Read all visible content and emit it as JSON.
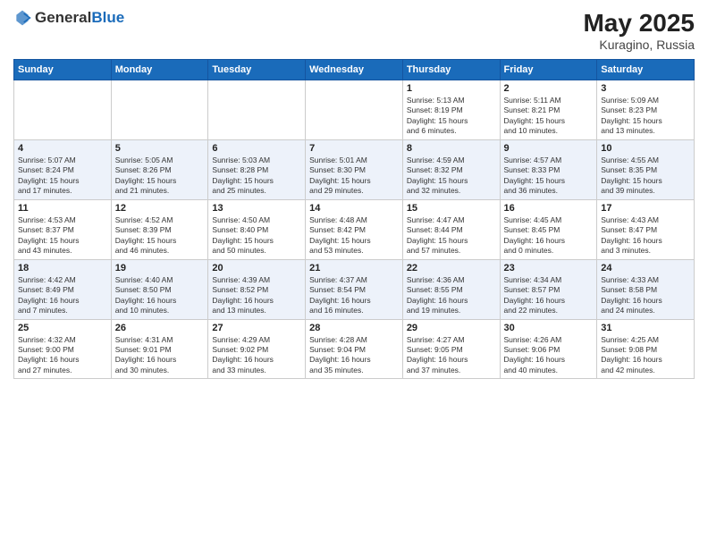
{
  "header": {
    "logo_general": "General",
    "logo_blue": "Blue",
    "month_year": "May 2025",
    "location": "Kuragino, Russia"
  },
  "days_of_week": [
    "Sunday",
    "Monday",
    "Tuesday",
    "Wednesday",
    "Thursday",
    "Friday",
    "Saturday"
  ],
  "weeks": [
    {
      "days": [
        {
          "number": "",
          "info": ""
        },
        {
          "number": "",
          "info": ""
        },
        {
          "number": "",
          "info": ""
        },
        {
          "number": "",
          "info": ""
        },
        {
          "number": "1",
          "info": "Sunrise: 5:13 AM\nSunset: 8:19 PM\nDaylight: 15 hours\nand 6 minutes."
        },
        {
          "number": "2",
          "info": "Sunrise: 5:11 AM\nSunset: 8:21 PM\nDaylight: 15 hours\nand 10 minutes."
        },
        {
          "number": "3",
          "info": "Sunrise: 5:09 AM\nSunset: 8:23 PM\nDaylight: 15 hours\nand 13 minutes."
        }
      ]
    },
    {
      "days": [
        {
          "number": "4",
          "info": "Sunrise: 5:07 AM\nSunset: 8:24 PM\nDaylight: 15 hours\nand 17 minutes."
        },
        {
          "number": "5",
          "info": "Sunrise: 5:05 AM\nSunset: 8:26 PM\nDaylight: 15 hours\nand 21 minutes."
        },
        {
          "number": "6",
          "info": "Sunrise: 5:03 AM\nSunset: 8:28 PM\nDaylight: 15 hours\nand 25 minutes."
        },
        {
          "number": "7",
          "info": "Sunrise: 5:01 AM\nSunset: 8:30 PM\nDaylight: 15 hours\nand 29 minutes."
        },
        {
          "number": "8",
          "info": "Sunrise: 4:59 AM\nSunset: 8:32 PM\nDaylight: 15 hours\nand 32 minutes."
        },
        {
          "number": "9",
          "info": "Sunrise: 4:57 AM\nSunset: 8:33 PM\nDaylight: 15 hours\nand 36 minutes."
        },
        {
          "number": "10",
          "info": "Sunrise: 4:55 AM\nSunset: 8:35 PM\nDaylight: 15 hours\nand 39 minutes."
        }
      ]
    },
    {
      "days": [
        {
          "number": "11",
          "info": "Sunrise: 4:53 AM\nSunset: 8:37 PM\nDaylight: 15 hours\nand 43 minutes."
        },
        {
          "number": "12",
          "info": "Sunrise: 4:52 AM\nSunset: 8:39 PM\nDaylight: 15 hours\nand 46 minutes."
        },
        {
          "number": "13",
          "info": "Sunrise: 4:50 AM\nSunset: 8:40 PM\nDaylight: 15 hours\nand 50 minutes."
        },
        {
          "number": "14",
          "info": "Sunrise: 4:48 AM\nSunset: 8:42 PM\nDaylight: 15 hours\nand 53 minutes."
        },
        {
          "number": "15",
          "info": "Sunrise: 4:47 AM\nSunset: 8:44 PM\nDaylight: 15 hours\nand 57 minutes."
        },
        {
          "number": "16",
          "info": "Sunrise: 4:45 AM\nSunset: 8:45 PM\nDaylight: 16 hours\nand 0 minutes."
        },
        {
          "number": "17",
          "info": "Sunrise: 4:43 AM\nSunset: 8:47 PM\nDaylight: 16 hours\nand 3 minutes."
        }
      ]
    },
    {
      "days": [
        {
          "number": "18",
          "info": "Sunrise: 4:42 AM\nSunset: 8:49 PM\nDaylight: 16 hours\nand 7 minutes."
        },
        {
          "number": "19",
          "info": "Sunrise: 4:40 AM\nSunset: 8:50 PM\nDaylight: 16 hours\nand 10 minutes."
        },
        {
          "number": "20",
          "info": "Sunrise: 4:39 AM\nSunset: 8:52 PM\nDaylight: 16 hours\nand 13 minutes."
        },
        {
          "number": "21",
          "info": "Sunrise: 4:37 AM\nSunset: 8:54 PM\nDaylight: 16 hours\nand 16 minutes."
        },
        {
          "number": "22",
          "info": "Sunrise: 4:36 AM\nSunset: 8:55 PM\nDaylight: 16 hours\nand 19 minutes."
        },
        {
          "number": "23",
          "info": "Sunrise: 4:34 AM\nSunset: 8:57 PM\nDaylight: 16 hours\nand 22 minutes."
        },
        {
          "number": "24",
          "info": "Sunrise: 4:33 AM\nSunset: 8:58 PM\nDaylight: 16 hours\nand 24 minutes."
        }
      ]
    },
    {
      "days": [
        {
          "number": "25",
          "info": "Sunrise: 4:32 AM\nSunset: 9:00 PM\nDaylight: 16 hours\nand 27 minutes."
        },
        {
          "number": "26",
          "info": "Sunrise: 4:31 AM\nSunset: 9:01 PM\nDaylight: 16 hours\nand 30 minutes."
        },
        {
          "number": "27",
          "info": "Sunrise: 4:29 AM\nSunset: 9:02 PM\nDaylight: 16 hours\nand 33 minutes."
        },
        {
          "number": "28",
          "info": "Sunrise: 4:28 AM\nSunset: 9:04 PM\nDaylight: 16 hours\nand 35 minutes."
        },
        {
          "number": "29",
          "info": "Sunrise: 4:27 AM\nSunset: 9:05 PM\nDaylight: 16 hours\nand 37 minutes."
        },
        {
          "number": "30",
          "info": "Sunrise: 4:26 AM\nSunset: 9:06 PM\nDaylight: 16 hours\nand 40 minutes."
        },
        {
          "number": "31",
          "info": "Sunrise: 4:25 AM\nSunset: 9:08 PM\nDaylight: 16 hours\nand 42 minutes."
        }
      ]
    }
  ]
}
